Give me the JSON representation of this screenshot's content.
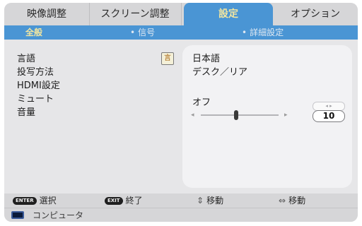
{
  "main_tabs": [
    {
      "label": "映像調整"
    },
    {
      "label": "スクリーン調整"
    },
    {
      "label": "設定"
    },
    {
      "label": "オプション"
    }
  ],
  "active_main_tab": "設定",
  "sub_tabs": [
    {
      "label": "全般"
    },
    {
      "label": "信号"
    },
    {
      "label": "詳細設定"
    }
  ],
  "active_sub_tab": "全般",
  "settings": {
    "language_label": "言語",
    "projection_label": "投写方法",
    "hdmi_label": "HDMI設定",
    "mute_label": "ミュート",
    "volume_label": "音量",
    "language_icon": "言",
    "language_value": "日本語",
    "projection_value": "デスク／リア",
    "mute_value": "オフ",
    "volume_value": "10",
    "volume_level": 0.45,
    "stepper_hint": "◂ ▸"
  },
  "footer_hints": [
    {
      "key": "ENTER",
      "label": "選択"
    },
    {
      "key": "EXIT",
      "label": "終了"
    },
    {
      "key": "⇕",
      "label": "移動"
    },
    {
      "key": "⇔",
      "label": "移動"
    }
  ],
  "status": {
    "source": "コンピュータ",
    "icon": "monitor-icon"
  },
  "colors": {
    "accent": "#4a95d4",
    "active_text": "#f2e6a0",
    "background": "#e6e6e8"
  }
}
